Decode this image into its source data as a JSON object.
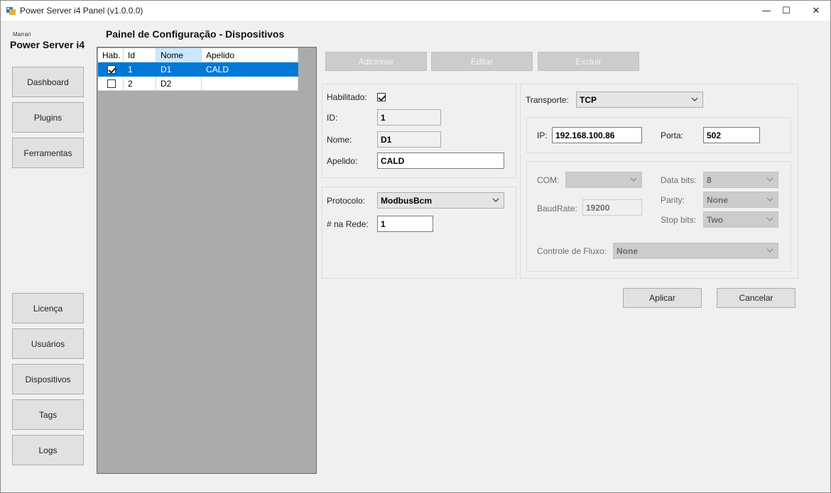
{
  "window": {
    "title": "Power Server i4 Panel (v1.0.0.0)",
    "minimize_glyph": "—",
    "maximize_glyph": "☐",
    "close_glyph": "✕"
  },
  "brand": {
    "company": "Marrari",
    "product": "Power Server i4"
  },
  "page_title": "Painel de Configuração - Dispositivos",
  "sidebar": {
    "top_items": [
      {
        "label": "Dashboard"
      },
      {
        "label": "Plugins"
      },
      {
        "label": "Ferramentas"
      }
    ],
    "bottom_items": [
      {
        "label": "Licença"
      },
      {
        "label": "Usuários"
      },
      {
        "label": "Dispositivos"
      },
      {
        "label": "Tags"
      },
      {
        "label": "Logs"
      }
    ]
  },
  "grid": {
    "columns": [
      "Hab.",
      "Id",
      "Nome",
      "Apelido"
    ],
    "rows": [
      {
        "enabled": true,
        "id": "1",
        "nome": "D1",
        "apelido": "CALD",
        "selected": true
      },
      {
        "enabled": false,
        "id": "2",
        "nome": "D2",
        "apelido": "",
        "selected": false
      }
    ]
  },
  "toolbar": {
    "add_label": "Adicionar",
    "edit_label": "Editar",
    "delete_label": "Excluir"
  },
  "device": {
    "enabled_label": "Habilitado:",
    "enabled": true,
    "id_label": "ID:",
    "id_value": "1",
    "name_label": "Nome:",
    "name_value": "D1",
    "alias_label": "Apelido:",
    "alias_value": "CALD"
  },
  "protocol": {
    "protocol_label": "Protocolo:",
    "protocol_value": "ModbusBcm",
    "network_label": "# na Rede:",
    "network_value": "1"
  },
  "transport": {
    "transport_label": "Transporte:",
    "transport_value": "TCP",
    "ip_label": "IP:",
    "ip_value": "192.168.100.86",
    "port_label": "Porta:",
    "port_value": "502"
  },
  "serial": {
    "com_label": "COM:",
    "com_value": "",
    "baud_label": "BaudRate:",
    "baud_value": "19200",
    "databits_label": "Data bits:",
    "databits_value": "8",
    "parity_label": "Parity:",
    "parity_value": "None",
    "stopbits_label": "Stop bits:",
    "stopbits_value": "Two",
    "flow_label": "Controle de Fluxo:",
    "flow_value": "None"
  },
  "actions": {
    "apply_label": "Aplicar",
    "cancel_label": "Cancelar"
  },
  "colors": {
    "selection": "#0078d7",
    "header_selected": "#cce8ff",
    "grid_background": "#ababab",
    "window_background": "#f0f0f0"
  }
}
